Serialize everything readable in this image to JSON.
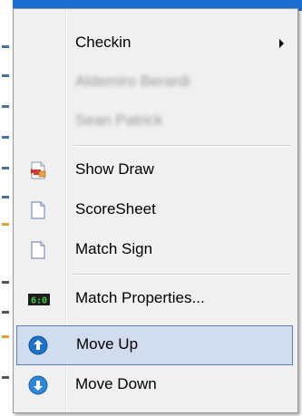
{
  "menu": {
    "items": [
      {
        "label": "Checkin",
        "icon": "none",
        "submenu": true
      },
      {
        "label": "Aldemiro Berardi",
        "icon": "none",
        "disabled": true
      },
      {
        "label": "Sean Patrick",
        "icon": "none",
        "disabled": true
      },
      {
        "label": "Show Draw",
        "icon": "draw-document-icon"
      },
      {
        "label": "ScoreSheet",
        "icon": "document-icon"
      },
      {
        "label": "Match Sign",
        "icon": "document-icon"
      },
      {
        "label": "Match Properties...",
        "icon": "score-display-icon"
      },
      {
        "label": "Move Up",
        "icon": "arrow-up-circle-icon",
        "selected": true
      },
      {
        "label": "Move Down",
        "icon": "arrow-down-circle-icon"
      }
    ],
    "score_icon_text": "6:0"
  },
  "colors": {
    "selected_bg": "#d1dcee",
    "selected_border": "#5a7fb8",
    "accent_blue": "#1e73c8"
  }
}
